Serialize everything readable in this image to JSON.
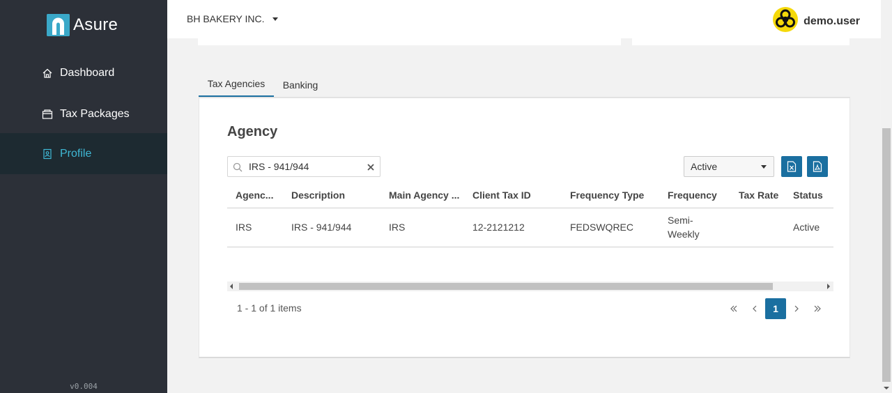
{
  "app": {
    "brand": "Asure",
    "version": "v0.004"
  },
  "sidebar": {
    "items": [
      {
        "label": "Dashboard",
        "icon": "home-icon"
      },
      {
        "label": "Tax Packages",
        "icon": "package-icon"
      },
      {
        "label": "Profile",
        "icon": "profile-icon",
        "active": true
      }
    ]
  },
  "header": {
    "company": "BH BAKERY INC.",
    "user": "demo.user",
    "avatar_icon": "biohazard-icon"
  },
  "tabs": [
    {
      "label": "Tax Agencies",
      "active": true
    },
    {
      "label": "Banking",
      "active": false
    }
  ],
  "panel": {
    "title": "Agency",
    "search": {
      "value": "IRS - 941/944",
      "placeholder": ""
    },
    "status_filter": "Active",
    "export_excel_icon": "excel-export-icon",
    "export_pdf_icon": "pdf-export-icon"
  },
  "grid": {
    "columns": [
      "Agenc...",
      "Description",
      "Main Agency ...",
      "Client Tax ID",
      "Frequency Type",
      "Frequency",
      "Tax Rate",
      "Status"
    ],
    "rows": [
      {
        "agency": "IRS",
        "description": "IRS - 941/944",
        "main_agency": "IRS",
        "client_tax_id": "12-2121212",
        "frequency_type": "FEDSWQREC",
        "frequency_line1": "Semi-",
        "frequency_line2": "Weekly",
        "tax_rate": "",
        "status": "Active"
      }
    ]
  },
  "pager": {
    "info": "1 - 1 of 1 items",
    "current_page": "1"
  },
  "colors": {
    "sidebar_bg": "#2c3038",
    "sidebar_active_bg": "#1d2a31",
    "accent": "#3fb8d5",
    "primary_button": "#1a6fa0"
  }
}
